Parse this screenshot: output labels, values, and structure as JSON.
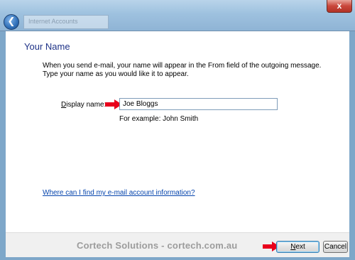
{
  "window": {
    "title": "Internet Accounts",
    "close_glyph": "x",
    "back_glyph": "❮"
  },
  "page": {
    "heading": "Your Name",
    "intro": "When you send e-mail, your name will appear in the From field of the outgoing message. Type your name as you would like it to appear.",
    "display_name_label_prefix": "",
    "display_name_label_accel": "D",
    "display_name_label_rest": "isplay name:",
    "display_name_value": "Joe Bloggs",
    "example_hint": "For example: John Smith",
    "help_link": "Where can I find my e-mail account information?"
  },
  "footer": {
    "watermark": "Cortech Solutions - cortech.com.au",
    "next_accel": "N",
    "next_rest": "ext",
    "cancel_label": "Cancel"
  },
  "colors": {
    "heading": "#1e3287",
    "link": "#0645ad",
    "annotation_arrow": "#e8001c"
  }
}
